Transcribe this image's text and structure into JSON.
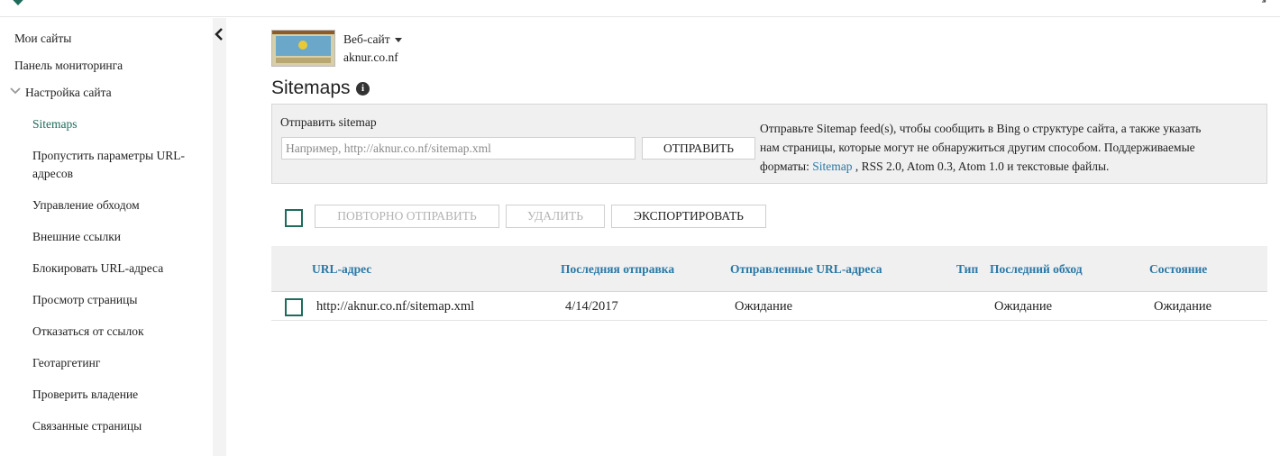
{
  "header": {
    "corner_arrow": "↘"
  },
  "sidebar": {
    "items": [
      {
        "label": "Мои сайты"
      },
      {
        "label": "Панель мониторинга"
      },
      {
        "label": "Настройка сайта"
      },
      {
        "label": "Sitemaps"
      },
      {
        "label": "Пропустить параметры URL-"
      },
      {
        "label": "адресов"
      },
      {
        "label": "Управление обходом"
      },
      {
        "label": "Внешние ссылки"
      },
      {
        "label": "Блокировать URL-адреса"
      },
      {
        "label": "Просмотр страницы"
      },
      {
        "label": "Отказаться от ссылок"
      },
      {
        "label": "Геотаргетинг"
      },
      {
        "label": "Проверить владение"
      },
      {
        "label": "Связанные страницы"
      }
    ],
    "active_color": "#1e6b5a"
  },
  "site": {
    "selector_label": "Веб-сайт",
    "domain": "aknur.co.nf"
  },
  "page": {
    "title": "Sitemaps",
    "info_icon": "i"
  },
  "submit": {
    "label": "Отправить sitemap",
    "input_placeholder": "Например, http://aknur.co.nf/sitemap.xml",
    "input_value": "",
    "button_label": "ОТПРАВИТЬ",
    "help_line1": "Отправьте Sitemap feed(s), чтобы сообщить в Bing о структуре сайта, а также указать",
    "help_line2": "нам страницы, которые могут не обнаружиться другим способом. Поддерживаемые",
    "help_line3_prefix": "форматы: ",
    "help_link": "Sitemap",
    "help_line3_suffix": " , RSS 2.0, Atom 0.3, Atom 1.0 и текстовые файлы."
  },
  "actions": {
    "resubmit": "ПОВТОРНО ОТПРАВИТЬ",
    "delete": "УДАЛИТЬ",
    "export": "ЭКСПОРТИРОВАТЬ"
  },
  "table": {
    "columns": [
      "URL-адрес",
      "Последняя отправка",
      "Отправленные URL-адреса",
      "Тип",
      "Последний обход",
      "Состояние"
    ],
    "rows": [
      {
        "url": "http://aknur.co.nf/sitemap.xml",
        "last_submitted": "4/14/2017",
        "submitted_urls": "Ожидание",
        "type": "",
        "last_crawled": "Ожидание",
        "status": "Ожидание"
      }
    ]
  },
  "colors": {
    "accent": "#1e6b5a",
    "link": "#2a78a6",
    "panel": "#f0f0f0"
  }
}
